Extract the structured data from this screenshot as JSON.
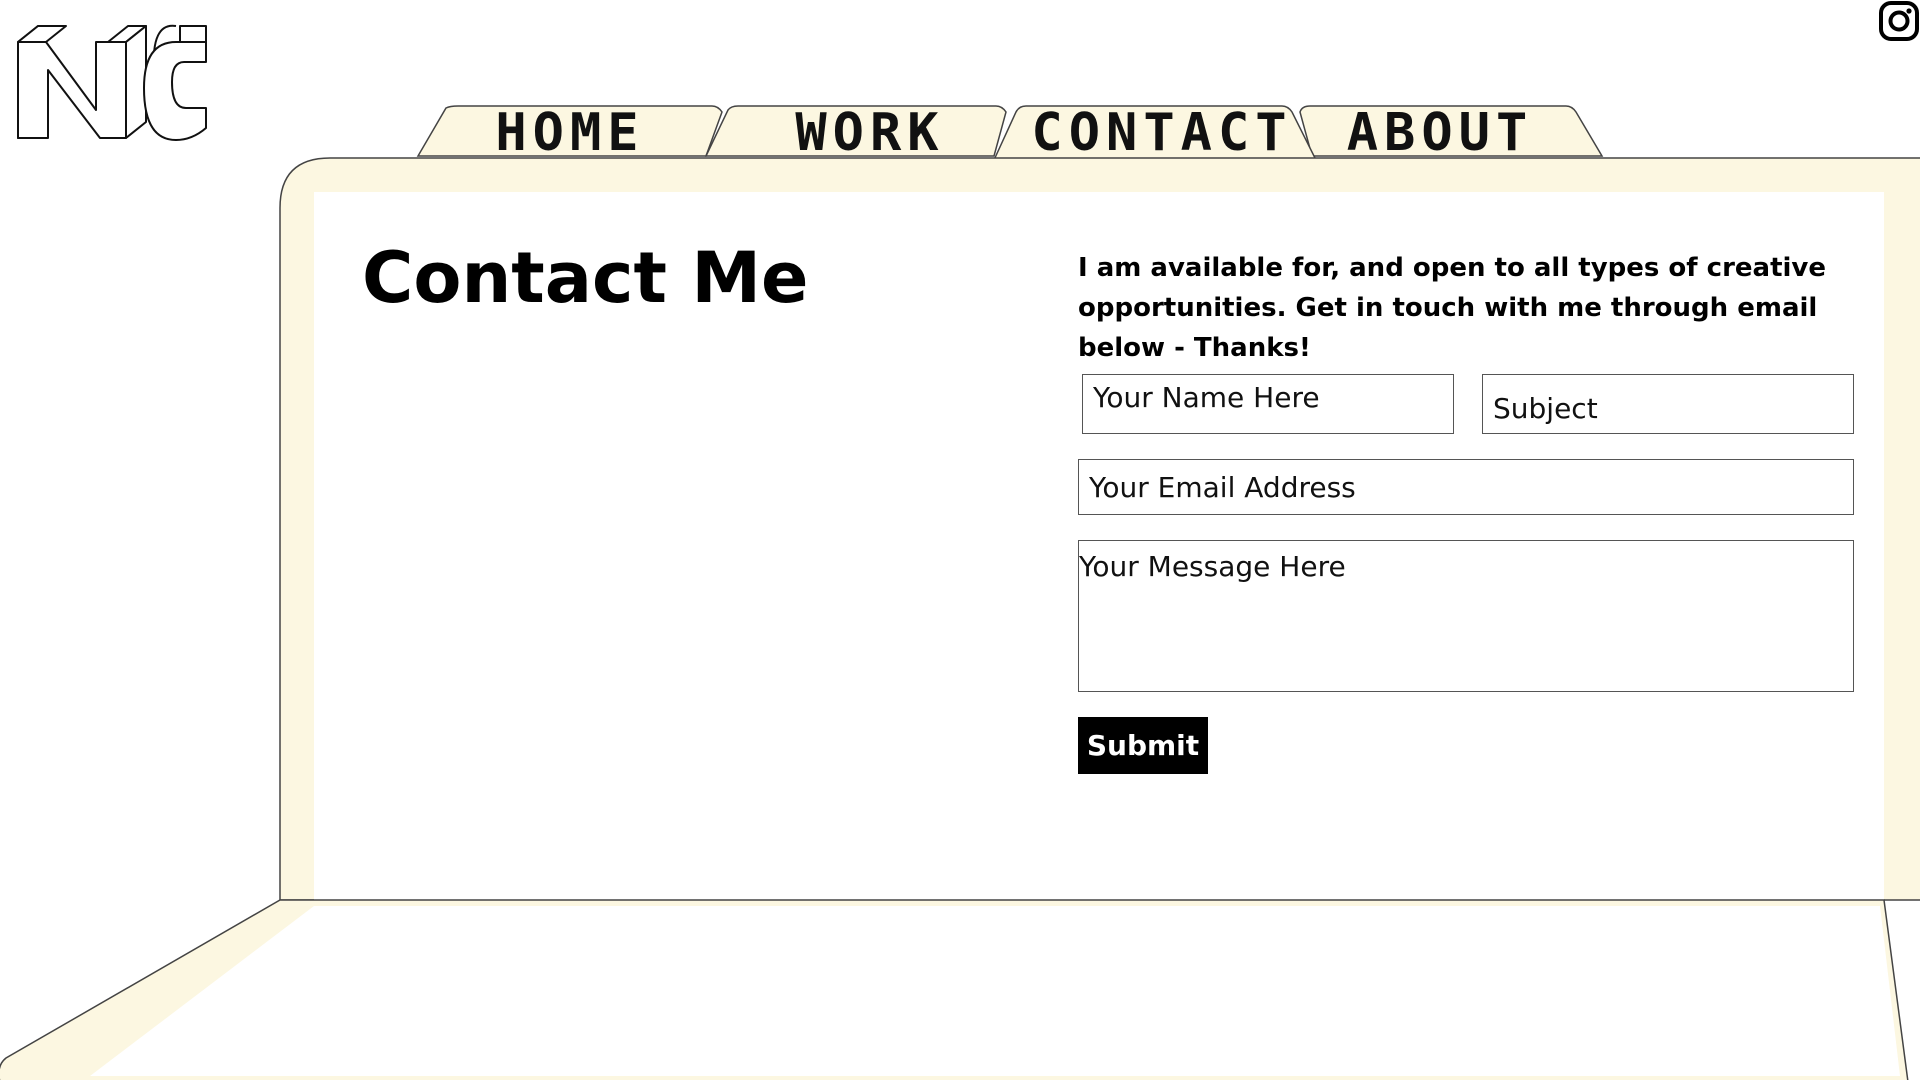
{
  "logo": {
    "text": "NC"
  },
  "nav": {
    "tabs": [
      {
        "label": "HOME"
      },
      {
        "label": "WORK"
      },
      {
        "label": "CONTACT"
      },
      {
        "label": "ABOUT"
      }
    ],
    "active_tab": "CONTACT"
  },
  "social": {
    "icon": "instagram-icon"
  },
  "main": {
    "title": "Contact Me",
    "intro": "I am available for, and open to all types of creative opportunities. Get in touch with me through email below - Thanks!",
    "form": {
      "name_placeholder": "Your Name Here",
      "subject_placeholder": "Subject",
      "email_placeholder": "Your Email Address",
      "message_placeholder": "Your Message Here",
      "submit_label": "Submit"
    }
  },
  "colors": {
    "folder_cream": "#fcf7e1",
    "text": "#000000",
    "button_bg": "#000000",
    "button_text": "#ffffff"
  }
}
